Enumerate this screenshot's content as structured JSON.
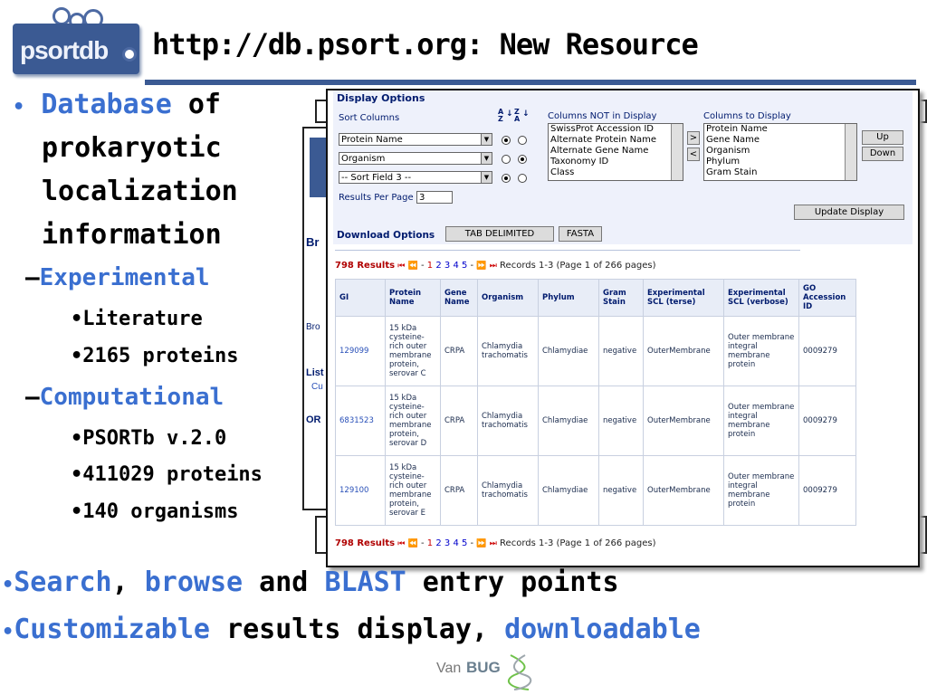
{
  "slide": {
    "logo_text": "psortdb",
    "title": "http://db.psort.org: New Resource",
    "colors": {
      "accent": "#3a6fd0",
      "rule": "#3b5a93",
      "logo": "#3b5a93"
    }
  },
  "bullets": {
    "b1_blue": "Database",
    "b1_rest": " of",
    "b1_l2": "prokaryotic",
    "b1_l3": "localization",
    "b1_l4": "information",
    "experimental": "Experimental",
    "exp_items": [
      "Literature",
      "2165 proteins"
    ],
    "computational": "Computational",
    "comp_items": [
      "PSORTb v.2.0",
      "411029 proteins",
      "140 organisms"
    ],
    "search": "Search",
    "comma": ",",
    "browse": "browse",
    "and": " and ",
    "blast": "BLAST",
    "entry_points": " entry points",
    "customizable": "Customizable",
    "results_display": " results display, ",
    "downloadable": "downloadable"
  },
  "bg_window": {
    "fragments": [
      "Br",
      "Bro",
      "List",
      "Cu",
      "OR"
    ]
  },
  "display_options": {
    "heading": "Display Options",
    "sort_label": "Sort Columns",
    "sort_az": "A Z",
    "sort_za": "Z A",
    "sort_fields": [
      "Protein Name",
      "Organism",
      "-- Sort Field 3 --"
    ],
    "not_in_display_label": "Columns NOT in Display",
    "not_in_display": [
      "SwissProt Accession ID",
      "Alternate Protein Name",
      "Alternate Gene Name",
      "Taxonomy ID",
      "Class"
    ],
    "to_display_label": "Columns to Display",
    "to_display": [
      "Protein Name",
      "Gene Name",
      "Organism",
      "Phylum",
      "Gram Stain"
    ],
    "move_right": ">",
    "move_left": "<",
    "up": "Up",
    "down": "Down",
    "results_per_page_label": "Results Per Page",
    "results_per_page": "3",
    "update": "Update Display"
  },
  "download": {
    "label": "Download Options",
    "tab": "TAB DELIMITED",
    "fasta": "FASTA"
  },
  "pager": {
    "count": "798 Results",
    "dash1": " - ",
    "current": "1",
    "pages": [
      "2",
      "3",
      "4",
      "5"
    ],
    "dash2": " - ",
    "records": "Records 1-3 (Page 1 of 266 pages)"
  },
  "table": {
    "headers": [
      "GI",
      "Protein Name",
      "Gene Name",
      "Organism",
      "Phylum",
      "Gram Stain",
      "Experimental SCL (terse)",
      "Experimental SCL (verbose)",
      "GO Accession ID"
    ],
    "rows": [
      [
        "129099",
        "15 kDa cysteine-rich outer membrane protein, serovar C",
        "CRPA",
        "Chlamydia trachomatis",
        "Chlamydiae",
        "negative",
        "OuterMembrane",
        "Outer membrane integral membrane protein",
        "0009279"
      ],
      [
        "6831523",
        "15 kDa cysteine-rich outer membrane protein, serovar D",
        "CRPA",
        "Chlamydia trachomatis",
        "Chlamydiae",
        "negative",
        "OuterMembrane",
        "Outer membrane integral membrane protein",
        "0009279"
      ],
      [
        "129100",
        "15 kDa cysteine-rich outer membrane protein, serovar E",
        "CRPA",
        "Chlamydia trachomatis",
        "Chlamydiae",
        "negative",
        "OuterMembrane",
        "Outer membrane integral membrane protein",
        "0009279"
      ]
    ]
  },
  "footer_logo": {
    "van": "Van",
    "bug": "BUG"
  }
}
